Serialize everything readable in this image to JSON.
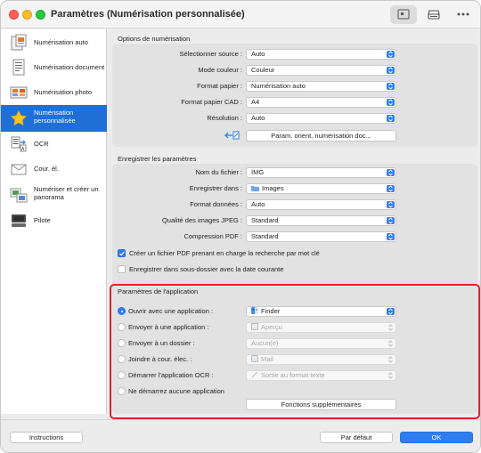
{
  "window": {
    "title": "Paramètres (Numérisation personnalisée)"
  },
  "toolbar": {
    "icons": [
      "scan-settings-icon",
      "scanner-icon",
      "more-icon"
    ]
  },
  "sidebar": {
    "items": [
      {
        "label": "Numérisation auto",
        "icon": "auto-scan-icon"
      },
      {
        "label": "Numérisation document",
        "icon": "document-scan-icon"
      },
      {
        "label": "Numérisation photo",
        "icon": "photo-scan-icon"
      },
      {
        "label": "Numérisation personnalisée",
        "icon": "star-icon",
        "selected": true
      },
      {
        "label": "OCR",
        "icon": "ocr-icon"
      },
      {
        "label": "Cour. él.",
        "icon": "mail-icon"
      },
      {
        "label": "Numériser et créer un panorama",
        "icon": "panorama-icon"
      },
      {
        "label": "Pilote",
        "icon": "driver-icon"
      }
    ]
  },
  "scan_options": {
    "title": "Options de numérisation",
    "source_label": "Sélectionner source :",
    "source_value": "Auto",
    "color_label": "Mode couleur :",
    "color_value": "Couleur",
    "paper_label": "Format papier :",
    "paper_value": "Numérisation auto",
    "cad_label": "Format papier CAD :",
    "cad_value": "A4",
    "resolution_label": "Résolution :",
    "resolution_value": "Auto",
    "orient_button": "Param. orient. numérisation doc..."
  },
  "save_settings": {
    "title": "Enregistrer les paramètres",
    "filename_label": "Nom du fichier :",
    "filename_value": "IMG",
    "save_in_label": "Enregistrer dans :",
    "save_in_value": "Images",
    "format_label": "Format données :",
    "format_value": "Auto",
    "jpeg_label": "Qualité des images JPEG :",
    "jpeg_value": "Standard",
    "pdf_label": "Compression PDF :",
    "pdf_value": "Standard",
    "searchable_pdf_label": "Créer un fichier PDF prenant en charge la recherche par mot clé",
    "searchable_pdf_checked": true,
    "subfolder_label": "Enregistrer dans sous-dossier avec la date courante",
    "subfolder_checked": false
  },
  "app_settings": {
    "title": "Paramètres de l'application",
    "open_app_label": "Ouvrir avec une application :",
    "open_app_value": "Finder",
    "send_app_label": "Envoyer à une application :",
    "send_app_value": "Aperçu",
    "send_folder_label": "Envoyer à un dossier :",
    "send_folder_value": "Aucun(e)",
    "attach_mail_label": "Joindre à cour. élec. :",
    "attach_mail_value": "Mail",
    "ocr_label": "Démarrer l'application OCR :",
    "ocr_value": "Sortie au format texte",
    "none_label": "Ne démarrez aucune application",
    "more_button": "Fonctions supplémentaires",
    "selected_option": "open_app"
  },
  "footer": {
    "instructions_button": "Instructions",
    "defaults_button": "Par défaut",
    "ok_button": "OK"
  },
  "colors": {
    "accent": "#2f7ef0",
    "selection": "#1f6fd6",
    "highlight_border": "#e2232a"
  }
}
